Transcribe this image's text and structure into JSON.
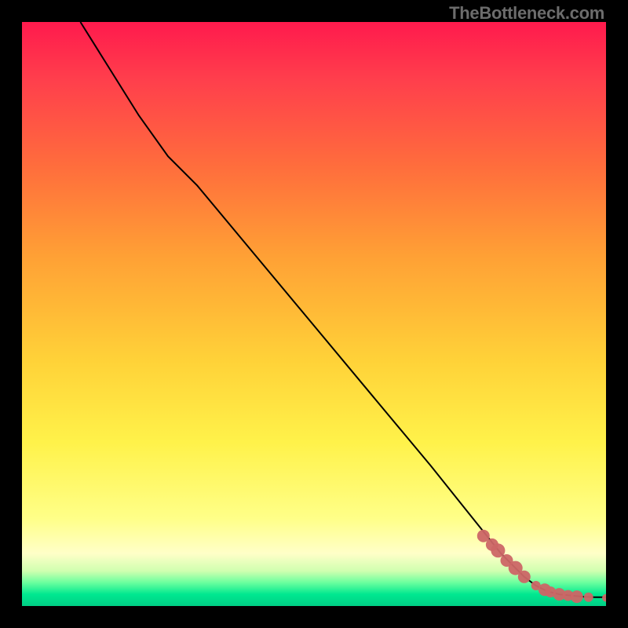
{
  "attribution": "TheBottleneck.com",
  "colors": {
    "marker": "#cc6666",
    "line": "#000000"
  },
  "chart_data": {
    "type": "line",
    "title": "",
    "xlabel": "",
    "ylabel": "",
    "xlim": [
      0,
      100
    ],
    "ylim": [
      0,
      100
    ],
    "grid": false,
    "line_series": {
      "name": "curve",
      "x": [
        10,
        15,
        20,
        25,
        30,
        40,
        50,
        60,
        70,
        78,
        82,
        86,
        88,
        90,
        92,
        94,
        96,
        98,
        100
      ],
      "y": [
        100,
        92,
        84,
        77,
        72,
        60,
        48,
        36,
        24,
        14,
        9,
        5,
        3.5,
        2.5,
        2,
        1.8,
        1.6,
        1.5,
        1.5
      ]
    },
    "marker_series": {
      "name": "points",
      "x": [
        79,
        80.5,
        81.5,
        83,
        84.5,
        86,
        88,
        89.5,
        90.5,
        92,
        93.5,
        95,
        97,
        100
      ],
      "y": [
        12,
        10.5,
        9.5,
        7.8,
        6.5,
        5.0,
        3.5,
        2.8,
        2.4,
        2.0,
        1.8,
        1.6,
        1.5,
        1.4
      ],
      "r": [
        8,
        8,
        9,
        8,
        9,
        8,
        6,
        8,
        7,
        8,
        7,
        8,
        6,
        5
      ]
    }
  }
}
